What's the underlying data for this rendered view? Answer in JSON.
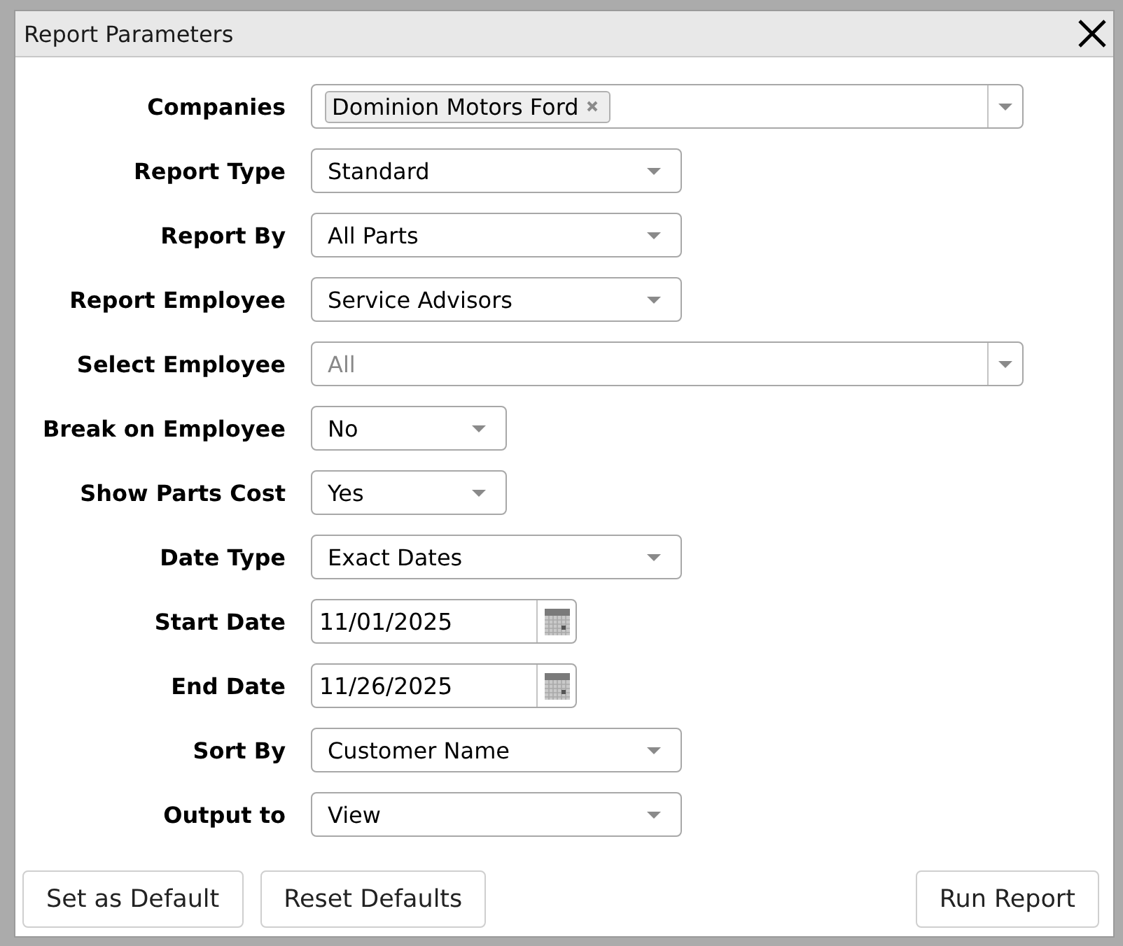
{
  "window": {
    "title": "Report Parameters"
  },
  "fields": [
    {
      "label": "Companies",
      "kind": "multiselect",
      "tags": [
        {
          "label": "Dominion Motors Ford"
        }
      ]
    },
    {
      "label": "Report Type",
      "kind": "select",
      "value": "Standard"
    },
    {
      "label": "Report By",
      "kind": "select",
      "value": "All Parts"
    },
    {
      "label": "Report Employee",
      "kind": "select",
      "value": "Service Advisors"
    },
    {
      "label": "Select Employee",
      "kind": "combobox",
      "placeholder": "All"
    },
    {
      "label": "Break on Employee",
      "kind": "select",
      "value": "No"
    },
    {
      "label": "Show Parts Cost",
      "kind": "select",
      "value": "Yes"
    },
    {
      "label": "Date Type",
      "kind": "select",
      "value": "Exact Dates"
    },
    {
      "label": "Start Date",
      "kind": "date",
      "value": "11/01/2025"
    },
    {
      "label": "End Date",
      "kind": "date",
      "value": "11/26/2025"
    },
    {
      "label": "Sort By",
      "kind": "select",
      "value": "Customer Name"
    },
    {
      "label": "Output to",
      "kind": "select",
      "value": "View"
    }
  ],
  "buttons": [
    {
      "label": "Set as Default"
    },
    {
      "label": "Reset Defaults"
    },
    {
      "label": "Run Report"
    }
  ]
}
